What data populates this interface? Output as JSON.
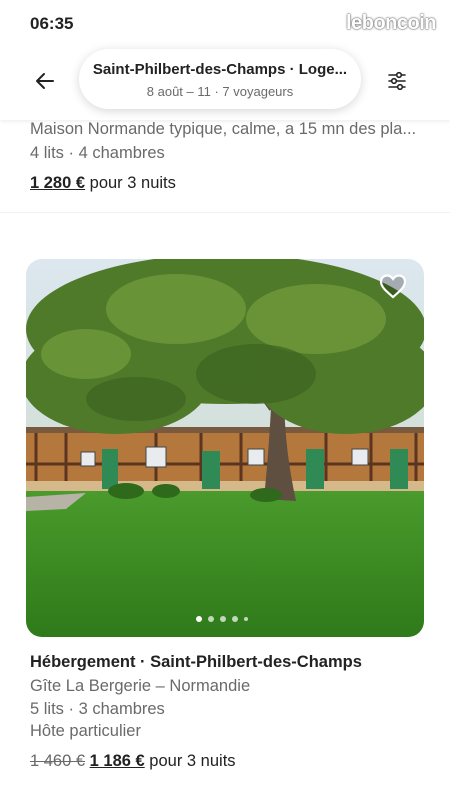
{
  "status_bar": {
    "time": "06:35",
    "watermark": "leboncoin"
  },
  "header": {
    "title": "Saint-Philbert-des-Champs · Loge...",
    "subtitle": "8 août – 11 · 7 voyageurs",
    "back_icon": "arrow-left-icon",
    "filter_icon": "sliders-icon"
  },
  "previous_listing": {
    "description": "Maison Normande typique, calme, a 15 mn des pla...",
    "beds": "4 lits · 4 chambres",
    "price": "1 280 €",
    "price_suffix": " pour 3 nuits"
  },
  "listing": {
    "favorite_icon": "heart-outline-icon",
    "photo_count": 5,
    "active_photo": 1,
    "title": "Hébergement · Saint-Philbert-des-Champs",
    "name": "Gîte La Bergerie – Normandie",
    "beds": "5 lits · 3 chambres",
    "host": "Hôte particulier",
    "old_price": "1 460 €",
    "price": "1 186 €",
    "price_suffix": " pour 3 nuits"
  }
}
